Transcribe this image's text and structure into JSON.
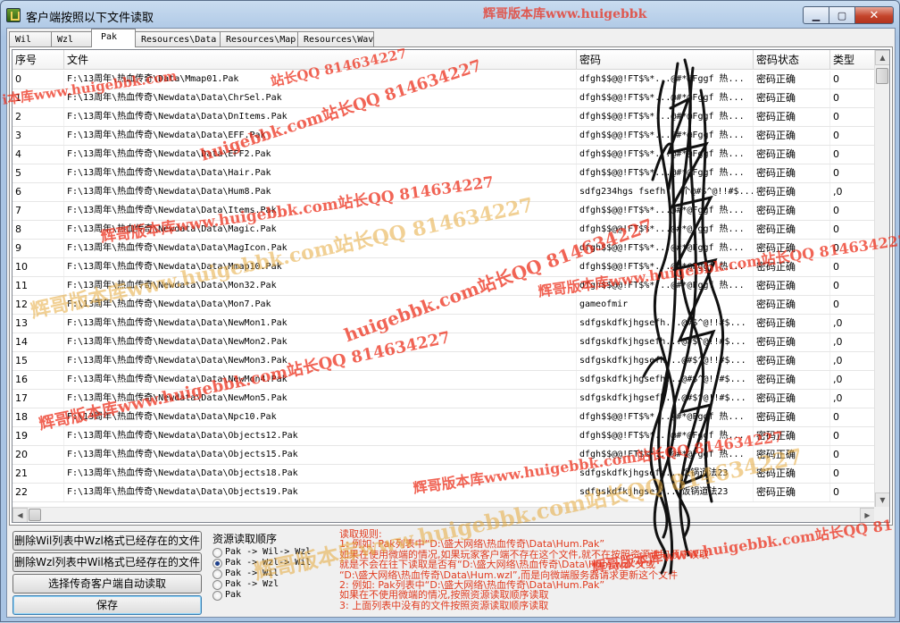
{
  "window": {
    "title": "客户端按照以下文件读取"
  },
  "tabs": [
    "Wil",
    "Wzl",
    "Pak",
    "Resources\\Data",
    "Resources\\Map",
    "Resources\\Wav"
  ],
  "active_tab": "Pak",
  "grid": {
    "columns": [
      "序号",
      "文件",
      "密码",
      "密码状态",
      "类型"
    ],
    "rows": [
      [
        "0",
        "F:\\13周年\\热血传奇\\Data\\Mmap01.Pak",
        "dfgh$$@@!FT$%*...@#*@Fggf  热...",
        "密码正确",
        "0"
      ],
      [
        "1",
        "F:\\13周年\\热血传奇\\Newdata\\Data\\ChrSel.Pak",
        "dfgh$$@@!FT$%*...@#*@Fggf  热...",
        "密码正确",
        "0"
      ],
      [
        "2",
        "F:\\13周年\\热血传奇\\Newdata\\Data\\DnItems.Pak",
        "dfgh$$@@!FT$%*...@#*@Fggf  热...",
        "密码正确",
        "0"
      ],
      [
        "3",
        "F:\\13周年\\热血传奇\\Newdata\\Data\\EFF.Pak",
        "dfgh$$@@!FT$%*...@#*@Fggf  热...",
        "密码正确",
        "0"
      ],
      [
        "4",
        "F:\\13周年\\热血传奇\\Newdata\\Data\\EFF2.Pak",
        "dfgh$$@@!FT$%*...@#*@Fggf  热...",
        "密码正确",
        "0"
      ],
      [
        "5",
        "F:\\13周年\\热血传奇\\Newdata\\Data\\Hair.Pak",
        "dfgh$$@@!FT$%*...@#*@Fggf  热...",
        "密码正确",
        "0"
      ],
      [
        "6",
        "F:\\13周年\\热血传奇\\Newdata\\Data\\Hum8.Pak",
        "sdfg234hgs  fsefh...个@#$^@!!#$...",
        "密码正确",
        ",0"
      ],
      [
        "7",
        "F:\\13周年\\热血传奇\\Newdata\\Data\\Items.Pak",
        "dfgh$$@@!FT$%*...@#*@Fggf  热...",
        "密码正确",
        "0"
      ],
      [
        "8",
        "F:\\13周年\\热血传奇\\Newdata\\Data\\Magic.Pak",
        "dfgh$$@@!FT$%*...@#*@Fggf  热...",
        "密码正确",
        "0"
      ],
      [
        "9",
        "F:\\13周年\\热血传奇\\Newdata\\Data\\MagIcon.Pak",
        "dfgh$$@@!FT$%*...@#*@Fggf  热...",
        "密码正确",
        "0"
      ],
      [
        "10",
        "F:\\13周年\\热血传奇\\Newdata\\Data\\Mmap10.Pak",
        "dfgh$$@@!FT$%*...@#*@Fggf  热...",
        "密码正确",
        "0"
      ],
      [
        "11",
        "F:\\13周年\\热血传奇\\Newdata\\Data\\Mon32.Pak",
        "dfgh$$@@!FT$%*...@#*@Fggf  热...",
        "密码正确",
        "0"
      ],
      [
        "12",
        "F:\\13周年\\热血传奇\\Newdata\\Data\\Mon7.Pak",
        "gameofmir",
        "密码正确",
        "0"
      ],
      [
        "13",
        "F:\\13周年\\热血传奇\\Newdata\\Data\\NewMon1.Pak",
        "sdfgskdfkjhgsefh...@#$^@!!#$...",
        "密码正确",
        ",0"
      ],
      [
        "14",
        "F:\\13周年\\热血传奇\\Newdata\\Data\\NewMon2.Pak",
        "sdfgskdfkjhgsefh...@#$^@!!#$...",
        "密码正确",
        ",0"
      ],
      [
        "15",
        "F:\\13周年\\热血传奇\\Newdata\\Data\\NewMon3.Pak",
        "sdfgskdfkjhgsefh...@#$^@!!#$...",
        "密码正确",
        ",0"
      ],
      [
        "16",
        "F:\\13周年\\热血传奇\\Newdata\\Data\\NewMon4.Pak",
        "sdfgskdfkjhgsefh...@#$^@!!#$...",
        "密码正确",
        ",0"
      ],
      [
        "17",
        "F:\\13周年\\热血传奇\\Newdata\\Data\\NewMon5.Pak",
        "sdfgskdfkjhgsefh...@#$^@!!#$...",
        "密码正确",
        ",0"
      ],
      [
        "18",
        "F:\\13周年\\热血传奇\\Newdata\\Data\\Npc10.Pak",
        "dfgh$$@@!FT$%*...@#*@Fggf  热...",
        "密码正确",
        "0"
      ],
      [
        "19",
        "F:\\13周年\\热血传奇\\Newdata\\Data\\Objects12.Pak",
        "dfgh$$@@!FT$%*...@#*@Fggf  热...",
        "密码正确",
        "0"
      ],
      [
        "20",
        "F:\\13周年\\热血传奇\\Newdata\\Data\\Objects15.Pak",
        "dfgh$$@@!FT$%*...@#*@Fggf  热...",
        "密码正确",
        "0"
      ],
      [
        "21",
        "F:\\13周年\\热血传奇\\Newdata\\Data\\Objects18.Pak",
        "sdfgskdfkjhgsefh...饭锅道法23",
        "密码正确",
        "0"
      ],
      [
        "22",
        "F:\\13周年\\热血传奇\\Newdata\\Data\\Objects19.Pak",
        "sdfgskdfkjhgsefh...饭锅道法23",
        "密码正确",
        "0"
      ]
    ]
  },
  "buttons": {
    "delete_wil": "删除Wil列表中Wzl格式已经存在的文件",
    "delete_wzl": "删除Wzl列表中Wil格式已经存在的文件",
    "auto_read": "选择传奇客户端自动读取",
    "save": "保存"
  },
  "resource_order": {
    "title": "资源读取顺序",
    "options": [
      "Pak -> Wil-> Wzl",
      "Pak -> Wzl-> Wil",
      "Pak -> Wil",
      "Pak -> Wzl",
      "Pak"
    ],
    "selected": 1
  },
  "rules": {
    "lines": [
      "读取规则:",
      "1: 例如: Pak列表中“D:\\盛大网络\\热血传奇\\Data\\Hum.Pak”",
      "   如果在使用微端的情况,如果玩家客户端不存在这个文件,就不在按照资源读取顺序读取",
      "   就是不会在往下读取是否有“D:\\盛大网络\\热血传奇\\Data\\Hum.wzl”文或",
      "   “D:\\盛大网络\\热血传奇\\Data\\Hum.wzl”,而是向微端服务器请求更新这个文件",
      "2: 例如: Pak列表中“D:\\盛大网络\\热血传奇\\Data\\Hum.Pak”",
      "   如果在不使用微端的情况,按照资源读取顺序读取",
      "3: 上面列表中没有的文件按照资源读取顺序读取"
    ]
  },
  "watermarks": [
    "辉哥版本库www.huigebbk",
    "辉哥版本库www.huigebbk.com站长QQ 814634227",
    "huigebbk.com站长QQ 814634227",
    "站长QQ 814634227",
    "辉哥版本库www.huigebbk.com站长QQ 814634227",
    "辉哥版本库www.huigebbk.com站长QQ 814634227",
    "huigebbk.com站长QQ 814634227",
    "辉哥版本库www.huigebbk.com站长QQ 814634227",
    "辉哥版本库www.huigebbk.com站长QQ 814634227",
    "辉哥版本库www.huigebbk.com站长QQ 814634227",
    "辉哥版本库www.huigebbk.com站长QQ 81",
    "i本库www.huigebbk.com"
  ],
  "colors": {
    "title_bg": "#a9c4e3",
    "close_button": "#c4452c",
    "rules_text": "#e13b1f",
    "watermark": "#eb2814"
  }
}
